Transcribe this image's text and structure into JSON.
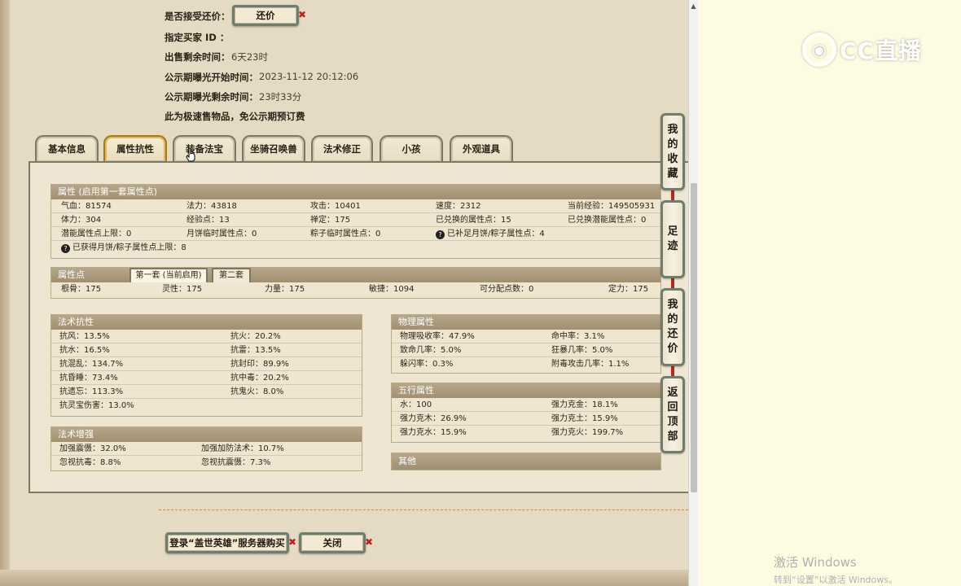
{
  "info": {
    "accept_counter_label": "是否接受还价：",
    "counter_button": "还价",
    "buyer_id_label": "指定买家 ID ：",
    "remaining_label": "出售剩余时间：",
    "remaining_value": "6天23时",
    "exposure_start_label": "公示期曝光开始时间：",
    "exposure_start_value": "2023-11-12 20:12:06",
    "exposure_remaining_label": "公示期曝光剩余时间：",
    "exposure_remaining_value": "23时33分",
    "fast_sale_note": "此为极速售物品，免公示期预订费"
  },
  "tabs": [
    "基本信息",
    "属性抗性",
    "装备法宝",
    "坐骑召唤兽",
    "法术修正",
    "小孩",
    "外观道具"
  ],
  "active_tab": 1,
  "attributes": {
    "header": "属性 (启用第一套属性点)",
    "rows": [
      [
        "气血：81574",
        "法力：43818",
        "攻击：10401",
        "速度：2312",
        "当前经验：149505931"
      ],
      [
        "体力：304",
        "经验点：13",
        "禅定：175",
        "已兑换的属性点：15",
        "已兑换潜能属性点：0"
      ],
      [
        "潜能属性点上限：0",
        "月饼临时属性点：0",
        "粽子临时属性点：0",
        "已补足月饼/粽子属性点：4",
        ""
      ]
    ],
    "note": "已获得月饼/粽子属性点上限：8"
  },
  "attr_points": {
    "header": "属性点",
    "subtabs": [
      "第一套 (当前启用)",
      "第二套"
    ],
    "values": [
      "根骨：175",
      "灵性：175",
      "力量：175",
      "敏捷：1094",
      "可分配点数：0",
      "定力：175"
    ]
  },
  "spell_resist": {
    "header": "法术抗性",
    "rows": [
      [
        "抗风：13.5%",
        "抗火：20.2%"
      ],
      [
        "抗水：16.5%",
        "抗雷：13.5%"
      ],
      [
        "抗混乱：134.7%",
        "抗封印：89.9%"
      ],
      [
        "抗昏睡：73.4%",
        "抗中毒：20.2%"
      ],
      [
        "抗遗忘：113.3%",
        "抗鬼火：8.0%"
      ],
      [
        "抗灵宝伤害：13.0%",
        ""
      ]
    ]
  },
  "spell_boost": {
    "header": "法术增强",
    "rows": [
      [
        "加强震慑：32.0%",
        "加强加防法术：10.7%"
      ],
      [
        "忽视抗毒：8.8%",
        "忽视抗震慑：7.3%"
      ]
    ]
  },
  "physical": {
    "header": "物理属性",
    "rows": [
      [
        "物理吸收率：47.9%",
        "命中率：3.1%"
      ],
      [
        "致命几率：5.0%",
        "狂暴几率：5.0%"
      ],
      [
        "躲闪率：0.3%",
        "附毒攻击几率：1.1%"
      ]
    ]
  },
  "five_elements": {
    "header": "五行属性",
    "rows": [
      [
        "水：100",
        "强力克金：18.1%"
      ],
      [
        "强力克木：26.9%",
        "强力克土：15.9%"
      ],
      [
        "强力克水：15.9%",
        "强力克火：199.7%"
      ]
    ]
  },
  "other": {
    "header": "其他"
  },
  "side_buttons": [
    [
      "我",
      "的",
      "收",
      "藏"
    ],
    [
      "足",
      "迹"
    ],
    [
      "我",
      "的",
      "还",
      "价"
    ],
    [
      "返",
      "回",
      "顶",
      "部"
    ]
  ],
  "footer": {
    "login_buy": "登录“盖世英雄”服务器购买",
    "close": "关闭"
  },
  "overlay": {
    "logo_text": "CC直播",
    "win_title": "激活 Windows",
    "win_sub": "转到“设置”以激活 Windows。"
  },
  "colors": {
    "accent_gold": "#a6791e",
    "header_brown": "#a08f70",
    "close_x_red": "#c0221c"
  },
  "icons": [
    "question-icon",
    "cursor-hand-icon",
    "close-x-icon",
    "scroll-up-arrow-icon",
    "cc-logo-icon"
  ]
}
